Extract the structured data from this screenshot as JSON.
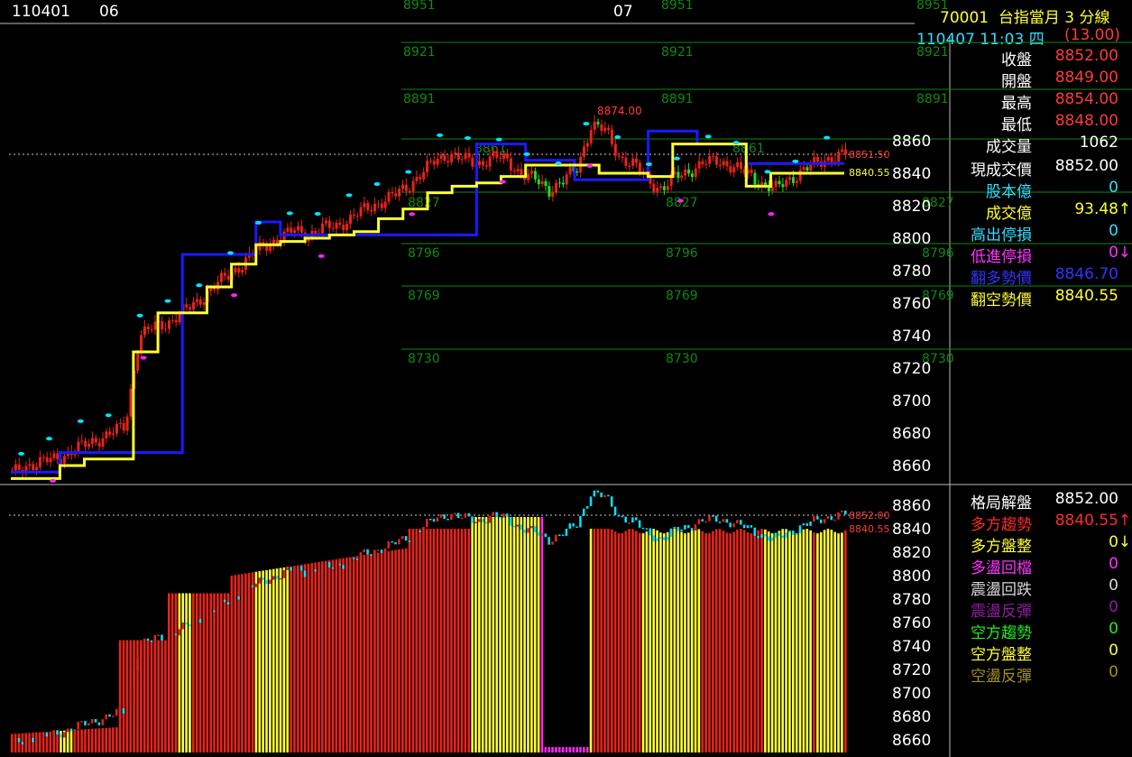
{
  "header": {
    "date_left": "110401",
    "day_06": "06",
    "day_07": "07",
    "title_code": "70001",
    "title_name": "台指當月 3 分線",
    "datetime": "110407 11:03 四",
    "change": "(13.00)"
  },
  "quote": {
    "close_label": "收盤",
    "close_value": "8852.00",
    "open_label": "開盤",
    "open_value": "8849.00",
    "high_label": "最高",
    "high_value": "8854.00",
    "low_label": "最低",
    "low_value": "8848.00",
    "volume_label": "成交量",
    "volume_value": "1062",
    "last_label": "現成交價",
    "last_value": "8852.00",
    "capital_label": "股本億",
    "capital_value": "0",
    "turnover_label": "成交億",
    "turnover_value": "93.48",
    "turnover_arrow": "↑",
    "high_stop_label": "高出停損",
    "high_stop_value": "0",
    "low_stop_label": "低進停損",
    "low_stop_value": "0",
    "low_stop_arrow": "↓",
    "bull_label": "翻多勢價",
    "bull_value": "8846.70",
    "bear_label": "翻空勢價",
    "bear_value": "8840.55"
  },
  "pattern": {
    "title_label": "格局解盤",
    "title_value": "8852.00",
    "items": [
      {
        "label": "多方趨勢",
        "value": "8840.55",
        "arrow": "↑",
        "label_color": "#ff2b2b",
        "value_color": "#ff2b2b"
      },
      {
        "label": "多方盤整",
        "value": "0",
        "arrow": "↓",
        "label_color": "#ffff33",
        "value_color": "#ffff33"
      },
      {
        "label": "多盪回檔",
        "value": "0",
        "arrow": "",
        "label_color": "#ff33ff",
        "value_color": "#ff33ff"
      },
      {
        "label": "震盪回跌",
        "value": "0",
        "arrow": "",
        "label_color": "#d8d8d8",
        "value_color": "#d8d8d8"
      },
      {
        "label": "震盪反彈",
        "value": "0",
        "arrow": "",
        "label_color": "#8a1f9e",
        "value_color": "#8a1f9e"
      },
      {
        "label": "空方趨勢",
        "value": "0",
        "arrow": "",
        "label_color": "#22ee22",
        "value_color": "#22ee22"
      },
      {
        "label": "空方盤整",
        "value": "0",
        "arrow": "",
        "label_color": "#ffff33",
        "value_color": "#ffff33"
      },
      {
        "label": "空盪反彈",
        "value": "0",
        "arrow": "",
        "label_color": "#a09020",
        "value_color": "#a09020"
      }
    ]
  },
  "top_chart": {
    "y_ticks": [
      "8860",
      "8840",
      "8820",
      "8800",
      "8780",
      "8760",
      "8740",
      "8720",
      "8700",
      "8680",
      "8660"
    ],
    "level_labels": [
      "8951",
      "8921",
      "8891",
      "8861",
      "8827",
      "8796",
      "8769",
      "8730"
    ],
    "high_tag": "8874.00",
    "price_tag_red": "8851.50",
    "price_tag_yellow": "8840.55"
  },
  "bottom_chart": {
    "y_ticks": [
      "8860",
      "8840",
      "8820",
      "8800",
      "8780",
      "8760",
      "8740",
      "8720",
      "8700",
      "8680",
      "8660"
    ],
    "price_tag_red": "8852.00",
    "price_tag_yellow": "8840.55"
  },
  "colors": {
    "up": "#e8231a",
    "down": "#22dd22",
    "bull_line": "#1a1aff",
    "bear_line": "#ffff33",
    "level": "#0e8a0e",
    "cyan": "#00e5ff",
    "magenta": "#ff22ff"
  },
  "chart_data": {
    "type": "line",
    "title": "台指當月 3 分線",
    "x_session_labels": [
      "110401",
      "06",
      "07"
    ],
    "price_range": [
      8650,
      8870
    ],
    "close_series": [
      8655,
      8660,
      8662,
      8664,
      8668,
      8672,
      8676,
      8680,
      8684,
      8740,
      8745,
      8748,
      8754,
      8760,
      8768,
      8775,
      8782,
      8790,
      8796,
      8800,
      8805,
      8802,
      8806,
      8808,
      8812,
      8818,
      8822,
      8826,
      8832,
      8840,
      8848,
      8852,
      8848,
      8846,
      8850,
      8848,
      8840,
      8836,
      8830,
      8835,
      8843,
      8870,
      8866,
      8850,
      8845,
      8836,
      8830,
      8838,
      8842,
      8846,
      8848,
      8844,
      8840,
      8834,
      8830,
      8836,
      8842,
      8846,
      8850,
      8852
    ],
    "bull_trend_line": [
      8656,
      8656,
      8668,
      8668,
      8668,
      8668,
      8668,
      8790,
      8790,
      8790,
      8810,
      8802,
      8802,
      8802,
      8802,
      8802,
      8802,
      8802,
      8802,
      8858,
      8858,
      8848,
      8848,
      8836,
      8836,
      8836,
      8866,
      8866,
      8858,
      8858,
      8846,
      8846,
      8846,
      8846
    ],
    "bear_trend_line": [
      8652,
      8652,
      8660,
      8664,
      8664,
      8730,
      8754,
      8754,
      8770,
      8784,
      8796,
      8798,
      8800,
      8802,
      8804,
      8812,
      8818,
      8828,
      8832,
      8834,
      8838,
      8845,
      8845,
      8845,
      8840,
      8840,
      8838,
      8858,
      8858,
      8858,
      8832,
      8840,
      8840,
      8840
    ],
    "levels": [
      8951,
      8921,
      8891,
      8861,
      8827,
      8796,
      8769,
      8730
    ]
  }
}
